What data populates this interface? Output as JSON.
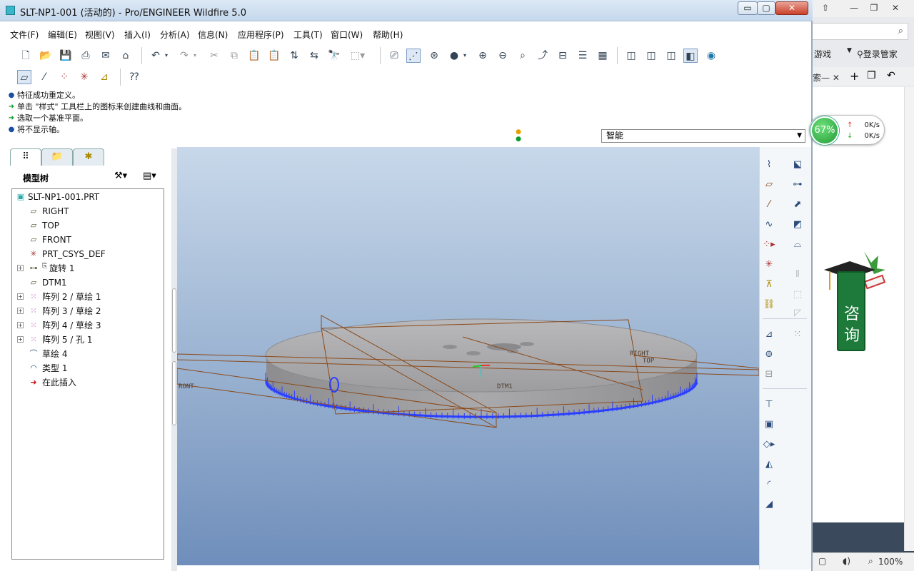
{
  "window": {
    "title": "SLT-NP1-001 (活动的) - Pro/ENGINEER Wildfire 5.0",
    "minimize": "▭",
    "maximize": "▢",
    "close": "✕"
  },
  "menubar": {
    "items": [
      "文件(F)",
      "编辑(E)",
      "视图(V)",
      "插入(I)",
      "分析(A)",
      "信息(N)",
      "应用程序(P)",
      "工具(T)",
      "窗口(W)",
      "帮助(H)"
    ]
  },
  "messages": [
    {
      "marker": "●",
      "text": "特征成功重定义。"
    },
    {
      "marker": "➜",
      "text": "单击 \"样式\" 工具栏上的图标来创建曲线和曲面。"
    },
    {
      "marker": "➜",
      "text": "选取一个基准平面。"
    },
    {
      "marker": "●",
      "text": "将不显示轴。"
    }
  ],
  "filter": {
    "value": "智能"
  },
  "model_tree": {
    "header": "模型树",
    "items": [
      {
        "label": "SLT-NP1-001.PRT",
        "icon": "part-icon"
      },
      {
        "label": "RIGHT",
        "icon": "datum-plane-icon"
      },
      {
        "label": "TOP",
        "icon": "datum-plane-icon"
      },
      {
        "label": "FRONT",
        "icon": "datum-plane-icon"
      },
      {
        "label": "PRT_CSYS_DEF",
        "icon": "csys-icon"
      },
      {
        "label": "旋转 1",
        "icon": "revolve-icon"
      },
      {
        "label": "DTM1",
        "icon": "datum-plane-icon"
      },
      {
        "label": "阵列 2 / 草绘 1",
        "icon": "pattern-icon"
      },
      {
        "label": "阵列 3 / 草绘 2",
        "icon": "pattern-icon"
      },
      {
        "label": "阵列 4 / 草绘 3",
        "icon": "pattern-icon"
      },
      {
        "label": "阵列 5 / 孔 1",
        "icon": "pattern-icon"
      },
      {
        "label": "草绘 4",
        "icon": "sketch-icon"
      },
      {
        "label": "类型 1",
        "icon": "style-icon"
      },
      {
        "label": "在此插入",
        "icon": "insert-here-icon"
      }
    ]
  },
  "viewport_labels": {
    "right": "RIGHT",
    "top": "TOP",
    "front": "RONT",
    "dtm": "DTM1"
  },
  "background_browser": {
    "games": "游戏",
    "manager": "登录管家",
    "tab": "索",
    "consult": "咨询",
    "zoom": "100%"
  },
  "speed_widget": {
    "percent": "67%",
    "up": "0K/s",
    "down": "0K/s"
  },
  "colors": {
    "viewport_top": "#c8d8ea",
    "viewport_bottom": "#6f8ebb",
    "datum_plane": "#8b4a1a",
    "part_gray": "#a8a8ab",
    "part_edge_blue": "#2a3fff"
  }
}
